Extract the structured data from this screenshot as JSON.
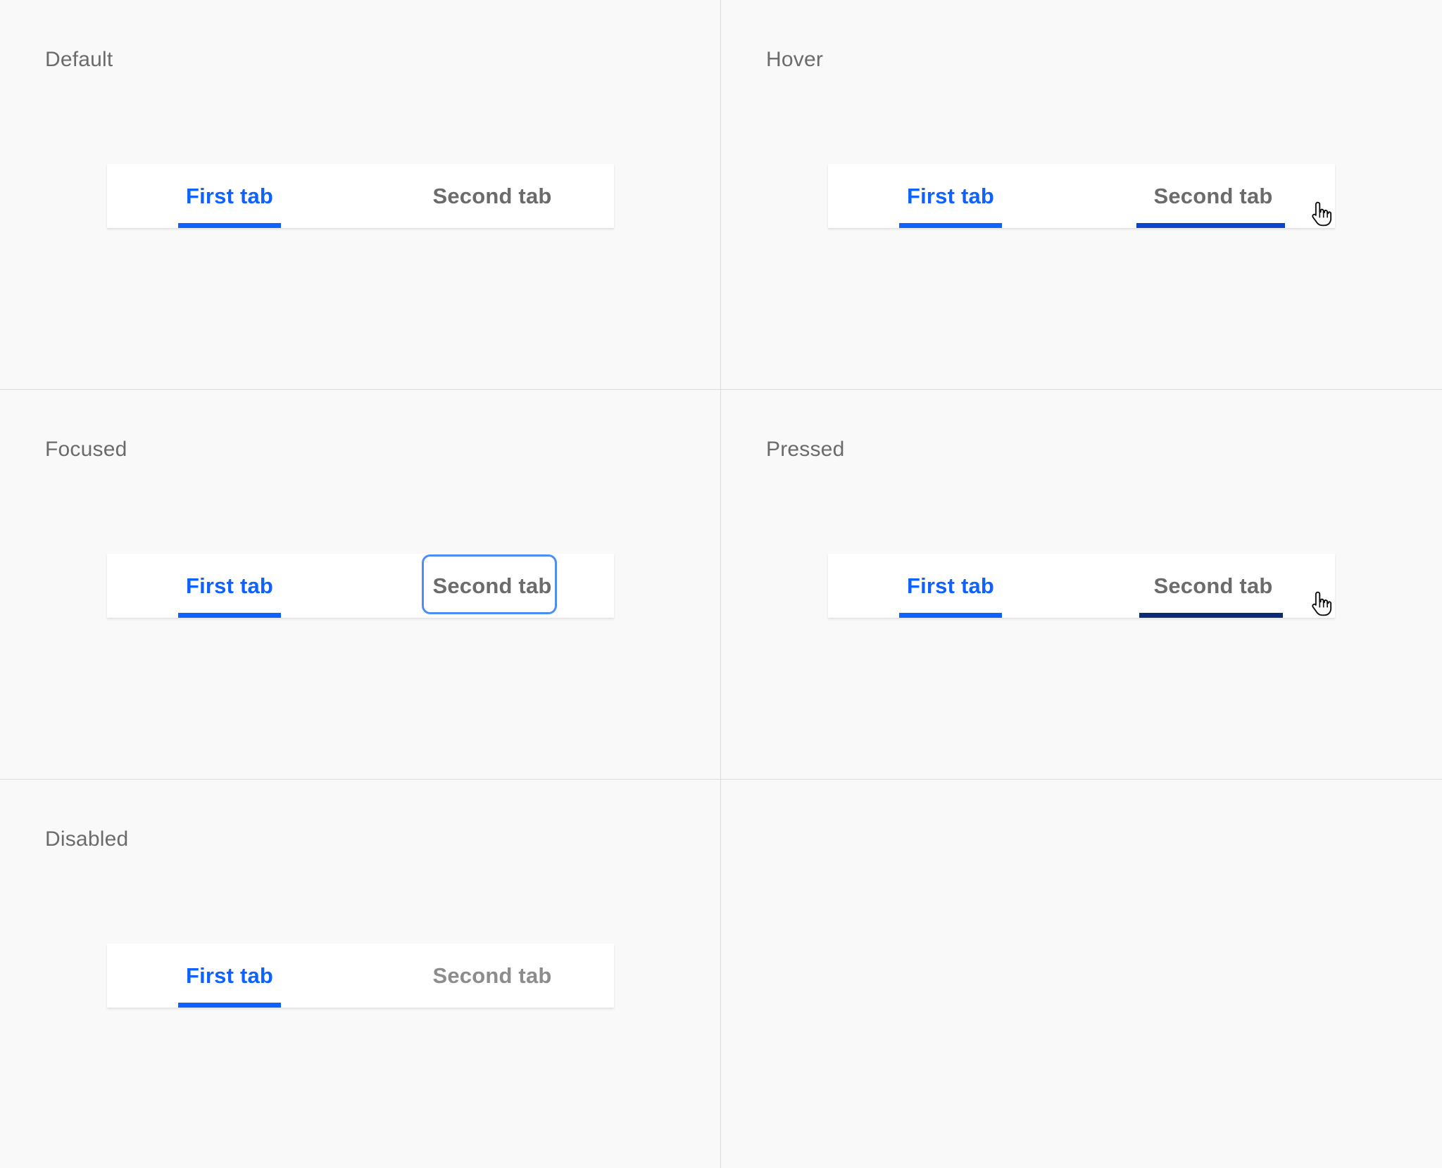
{
  "states": [
    {
      "label": "Default",
      "tabs": [
        "First tab",
        "Second tab"
      ]
    },
    {
      "label": "Hover",
      "tabs": [
        "First tab",
        "Second tab"
      ]
    },
    {
      "label": "Focused",
      "tabs": [
        "First tab",
        "Second tab"
      ]
    },
    {
      "label": "Pressed",
      "tabs": [
        "First tab",
        "Second tab"
      ]
    },
    {
      "label": "Disabled",
      "tabs": [
        "First tab",
        "Second tab"
      ]
    }
  ],
  "colors": {
    "active_blue": "#0f62fe",
    "hover_underline": "#0b45c9",
    "pressed_underline": "#0a2c74",
    "focus_ring": "#4c8ef5",
    "inactive_text": "#6b6b6b",
    "disabled_text": "#8c8c8c",
    "background": "#f9f9f9",
    "divider": "#dcdcdc"
  },
  "icons": {
    "cursor": "hand-pointer-cursor-icon"
  }
}
